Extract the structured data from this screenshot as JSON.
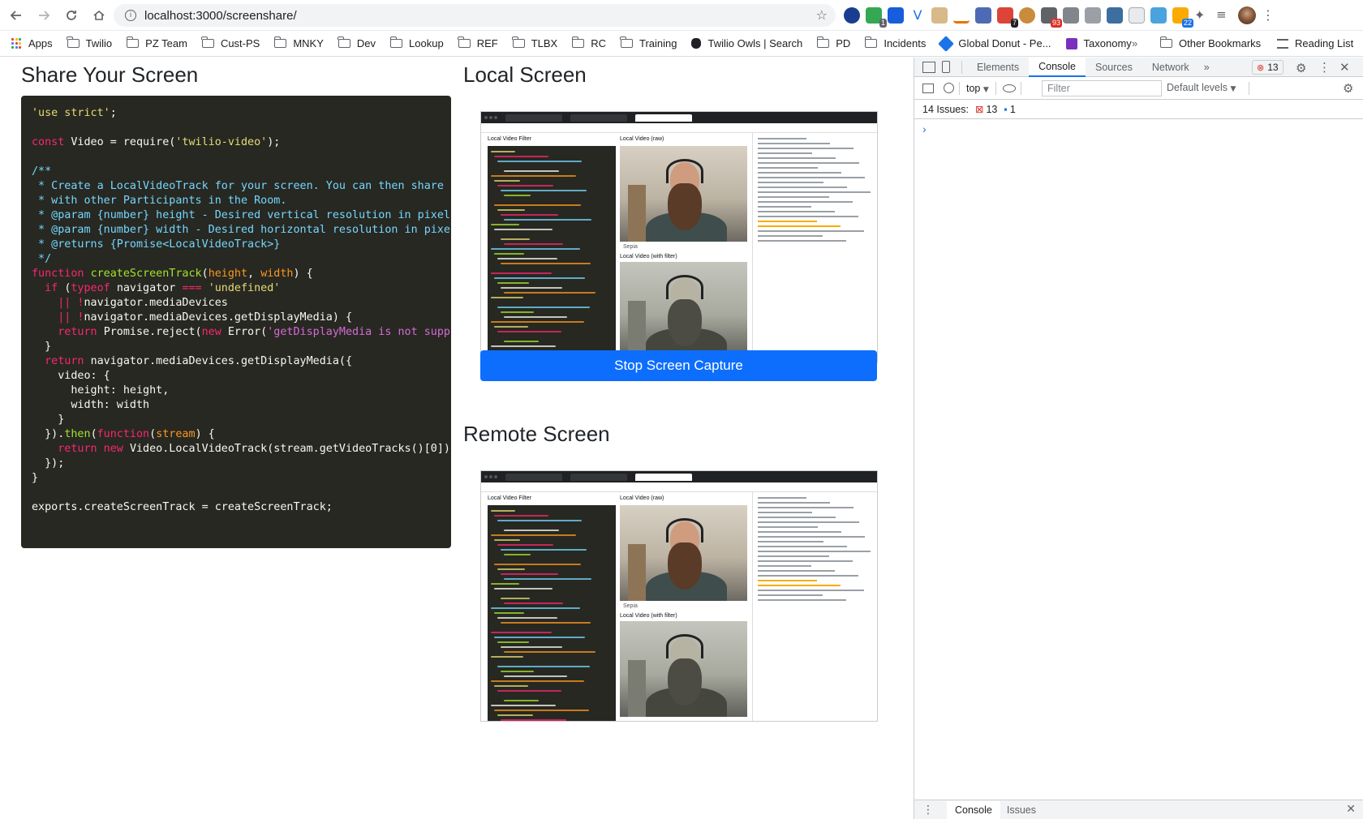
{
  "browser": {
    "url": "localhost:3000/screenshare/",
    "extension_badges": [
      "1",
      "7",
      "93",
      "22"
    ]
  },
  "bookmarks": {
    "items": [
      "Apps",
      "Twilio",
      "PZ Team",
      "Cust-PS",
      "MNKY",
      "Dev",
      "Lookup",
      "REF",
      "TLBX",
      "RC",
      "Training",
      "Twilio Owls | Search",
      "PD",
      "Incidents",
      "Global Donut - Pe...",
      "Taxonomy"
    ],
    "more": "»",
    "other": "Other Bookmarks",
    "reading_list": "Reading List"
  },
  "page": {
    "share_title": "Share Your Screen",
    "local_title": "Local Screen",
    "remote_title": "Remote Screen",
    "stop_button": "Stop Screen Capture"
  },
  "code_lines": [
    [
      [
        "str",
        "'use strict'"
      ],
      [
        "pun",
        ";"
      ]
    ],
    [],
    [
      [
        "kw",
        "const "
      ],
      [
        "pun",
        "Video = "
      ],
      [
        "pun",
        "require("
      ],
      [
        "str",
        "'twilio-video'"
      ],
      [
        "pun",
        ");"
      ]
    ],
    [],
    [
      [
        "cm",
        "/**"
      ]
    ],
    [
      [
        "cm",
        " * Create a LocalVideoTrack for your screen. You can then share it"
      ]
    ],
    [
      [
        "cm",
        " * with other Participants in the Room."
      ]
    ],
    [
      [
        "cm",
        " * @param {number} height - Desired vertical resolution in pixels"
      ]
    ],
    [
      [
        "cm",
        " * @param {number} width - Desired horizontal resolution in pixels"
      ]
    ],
    [
      [
        "cm",
        " * @returns {Promise<LocalVideoTrack>}"
      ]
    ],
    [
      [
        "cm",
        " */"
      ]
    ],
    [
      [
        "kw",
        "function "
      ],
      [
        "fn",
        "createScreenTrack"
      ],
      [
        "pun",
        "("
      ],
      [
        "pm",
        "height"
      ],
      [
        "pun",
        ", "
      ],
      [
        "pm",
        "width"
      ],
      [
        "pun",
        ") {"
      ]
    ],
    [
      [
        "pun",
        "  "
      ],
      [
        "kw",
        "if "
      ],
      [
        "pun",
        "("
      ],
      [
        "kw",
        "typeof "
      ],
      [
        "pun",
        "navigator "
      ],
      [
        "kw",
        "=== "
      ],
      [
        "str",
        "'undefined'"
      ]
    ],
    [
      [
        "pun",
        "    "
      ],
      [
        "kw",
        "|| !"
      ],
      [
        "pun",
        "navigator.mediaDevices"
      ]
    ],
    [
      [
        "pun",
        "    "
      ],
      [
        "kw",
        "|| !"
      ],
      [
        "pun",
        "navigator.mediaDevices.getDisplayMedia) {"
      ]
    ],
    [
      [
        "pun",
        "    "
      ],
      [
        "kw",
        "return "
      ],
      [
        "pun",
        "Promise.reject("
      ],
      [
        "kw",
        "new "
      ],
      [
        "pun",
        "Error("
      ],
      [
        "str2",
        "'getDisplayMedia is not suppor"
      ]
    ],
    [
      [
        "pun",
        "  }"
      ]
    ],
    [
      [
        "pun",
        "  "
      ],
      [
        "kw",
        "return "
      ],
      [
        "pun",
        "navigator.mediaDevices.getDisplayMedia({"
      ]
    ],
    [
      [
        "pun",
        "    video: {"
      ]
    ],
    [
      [
        "pun",
        "      height: height,"
      ]
    ],
    [
      [
        "pun",
        "      width: width"
      ]
    ],
    [
      [
        "pun",
        "    }"
      ]
    ],
    [
      [
        "pun",
        "  })."
      ],
      [
        "fn",
        "then"
      ],
      [
        "pun",
        "("
      ],
      [
        "kw",
        "function"
      ],
      [
        "pun",
        "("
      ],
      [
        "pm",
        "stream"
      ],
      [
        "pun",
        ") {"
      ]
    ],
    [
      [
        "pun",
        "    "
      ],
      [
        "kw",
        "return new "
      ],
      [
        "pun",
        "Video.LocalVideoTrack(stream.getVideoTracks()[0]);"
      ]
    ],
    [
      [
        "pun",
        "  });"
      ]
    ],
    [
      [
        "pun",
        "}"
      ]
    ],
    [],
    [
      [
        "pun",
        "exports.createScreenTrack = createScreenTrack;"
      ]
    ]
  ],
  "thumbnail": {
    "label_filter": "Local Video Filter",
    "label_raw": "Local Video (raw)",
    "label_with_filter": "Local Video (with filter)",
    "select_value": "Sepia"
  },
  "devtools": {
    "tabs": [
      "Elements",
      "Console",
      "Sources",
      "Network"
    ],
    "active_tab": "Console",
    "more_tabs": "»",
    "error_count": "13",
    "context": "top",
    "filter_placeholder": "Filter",
    "levels": "Default levels",
    "issues_label": "14 Issues:",
    "issues_errors": "13",
    "issues_info": "1",
    "prompt": "›",
    "drawer_tabs": [
      "Console",
      "Issues"
    ]
  },
  "colors": {
    "primary_button": "#0d6efd",
    "code_bg": "#272822"
  }
}
